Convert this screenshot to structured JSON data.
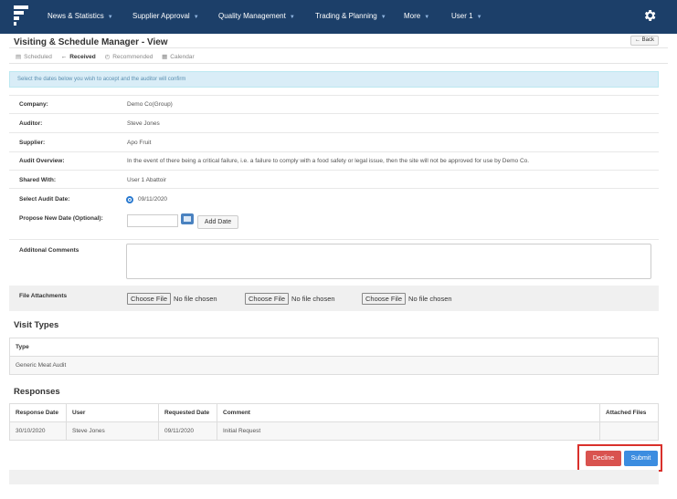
{
  "nav": {
    "items": [
      {
        "label": "News & Statistics"
      },
      {
        "label": "Supplier Approval"
      },
      {
        "label": "Quality Management"
      },
      {
        "label": "Trading & Planning"
      },
      {
        "label": "More"
      },
      {
        "label": "User 1"
      }
    ],
    "caret": "▼",
    "brand_color": "#1c3f69"
  },
  "page": {
    "title": "Visiting & Schedule Manager - View",
    "back_label": "← Back"
  },
  "tabs": [
    {
      "label": "Scheduled",
      "icon": "list-icon",
      "glyph": "▤",
      "active": false
    },
    {
      "label": "Received",
      "icon": "arrow-left-icon",
      "glyph": "←",
      "active": true
    },
    {
      "label": "Recommended",
      "icon": "clock-icon",
      "glyph": "◴",
      "active": false
    },
    {
      "label": "Calendar",
      "icon": "calendar-icon",
      "glyph": "▦",
      "active": false
    }
  ],
  "info_text": "Select the dates below you wish to accept and the auditor will confirm",
  "fields": {
    "company": {
      "label": "Company:",
      "value": "Demo Co(Group)"
    },
    "auditor": {
      "label": "Auditor:",
      "value": "Steve Jones"
    },
    "supplier": {
      "label": "Supplier:",
      "value": "Apo Fruit"
    },
    "overview": {
      "label": "Audit Overview:",
      "value": "In the event of there being a critical failure, i.e. a failure to comply with a food safety or legal issue, then the site will not be approved for use by Demo Co."
    },
    "shared": {
      "label": "Shared With:",
      "value": "User 1 Abattoir"
    },
    "audit_date": {
      "label": "Select Audit Date:",
      "value": "09/11/2020"
    },
    "propose": {
      "label": "Propose New Date (Optional):",
      "input_value": "",
      "add_label": "Add Date"
    },
    "comments": {
      "label": "Additonal Comments",
      "value": ""
    },
    "attachments": {
      "label": "File Attachments",
      "files": [
        {
          "button": "Choose File",
          "status": "No file chosen"
        },
        {
          "button": "Choose File",
          "status": "No file chosen"
        },
        {
          "button": "Choose File",
          "status": "No file chosen"
        }
      ]
    }
  },
  "visit_types": {
    "heading": "Visit Types",
    "header": "Type",
    "rows": [
      "Generic Meat Audit"
    ]
  },
  "responses": {
    "heading": "Responses",
    "columns": [
      "Response Date",
      "User",
      "Requested Date",
      "Comment",
      "Attached Files"
    ],
    "rows": [
      [
        "30/10/2020",
        "Steve Jones",
        "09/11/2020",
        "Initial Request",
        ""
      ]
    ]
  },
  "actions": {
    "decline_label": "Decline",
    "submit_label": "Submit",
    "decline_color": "#d9534f",
    "submit_color": "#3c8de0",
    "highlight_color": "#d9302b"
  }
}
